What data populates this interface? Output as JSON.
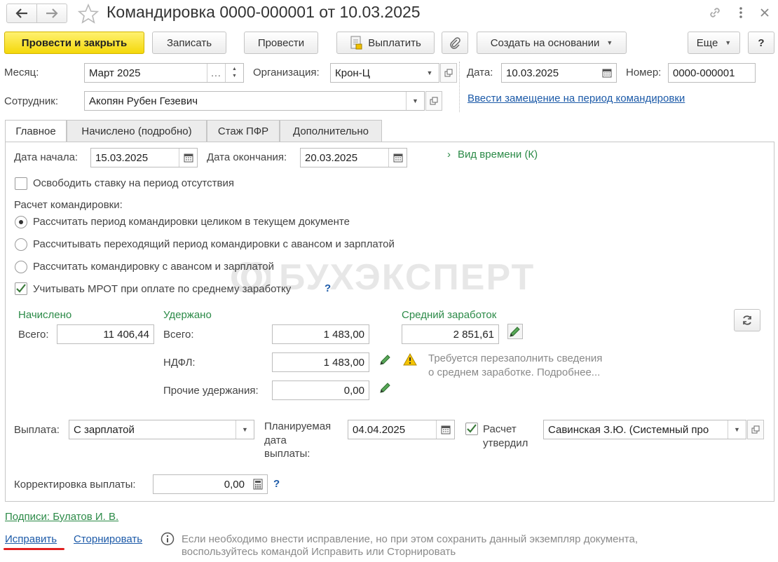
{
  "header": {
    "title": "Командировка 0000-000001 от 10.03.2025"
  },
  "toolbar": {
    "post_close": "Провести и закрыть",
    "save": "Записать",
    "post": "Провести",
    "pay": "Выплатить",
    "create_based": "Создать на основании",
    "more": "Еще",
    "help": "?"
  },
  "head_fields": {
    "month_label": "Месяц:",
    "month_value": "Март 2025",
    "org_label": "Организация:",
    "org_value": "Крон-Ц",
    "date_label": "Дата:",
    "date_value": "10.03.2025",
    "number_label": "Номер:",
    "number_value": "0000-000001",
    "employee_label": "Сотрудник:",
    "employee_value": "Акопян Рубен Гезевич",
    "replacement_link": "Ввести замещение на период командировки"
  },
  "tabs": [
    {
      "label": "Главное"
    },
    {
      "label": "Начислено (подробно)"
    },
    {
      "label": "Стаж ПФР"
    },
    {
      "label": "Дополнительно"
    }
  ],
  "main": {
    "start_label": "Дата начала:",
    "start_value": "15.03.2025",
    "end_label": "Дата окончания:",
    "end_value": "20.03.2025",
    "time_kind": "Вид времени (К)",
    "free_rate": "Освободить ставку на период отсутствия",
    "calc_title": "Расчет командировки:",
    "radio1": "Рассчитать период командировки целиком в текущем документе",
    "radio2": "Рассчитывать переходящий период командировки с авансом и зарплатой",
    "radio3": "Рассчитать командировку с авансом и зарплатой",
    "mrot": "Учитывать МРОТ при оплате по среднему заработку",
    "help_q": "?",
    "watermark": "БУХЭКСПЕРТ"
  },
  "sums": {
    "accrued_title": "Начислено",
    "total_label": "Всего:",
    "accrued_total": "11 406,44",
    "withheld_title": "Удержано",
    "withheld_total": "1 483,00",
    "ndfl_label": "НДФЛ:",
    "ndfl_value": "1 483,00",
    "other_label": "Прочие удержания:",
    "other_value": "0,00",
    "avg_title": "Средний заработок",
    "avg_value": "2 851,61",
    "warning_line1": "Требуется перезаполнить сведения",
    "warning_line2": "о среднем заработке. Подробнее..."
  },
  "payment": {
    "label": "Выплата:",
    "value": "С зарплатой",
    "planned_label_1": "Планируемая",
    "planned_label_2": "дата",
    "planned_label_3": "выплаты:",
    "planned_value": "04.04.2025",
    "approved_label_1": "Расчет",
    "approved_label_2": "утвердил",
    "approved_value": "Савинская З.Ю. (Системный про",
    "correction_label": "Корректировка выплаты:",
    "correction_value": "0,00"
  },
  "footer": {
    "signatures": "Подписи: Булатов И. В.",
    "fix": "Исправить",
    "storno": "Сторнировать",
    "info_line1": "Если необходимо внести исправление, но при этом сохранить данный экземпляр документа,",
    "info_line2": "воспользуйтесь командой Исправить или Сторнировать"
  },
  "colors": {
    "primary_button": "#f4d80a",
    "link": "#1c5aa8",
    "section_green": "#2b8a47",
    "underline_red": "#e02020"
  }
}
